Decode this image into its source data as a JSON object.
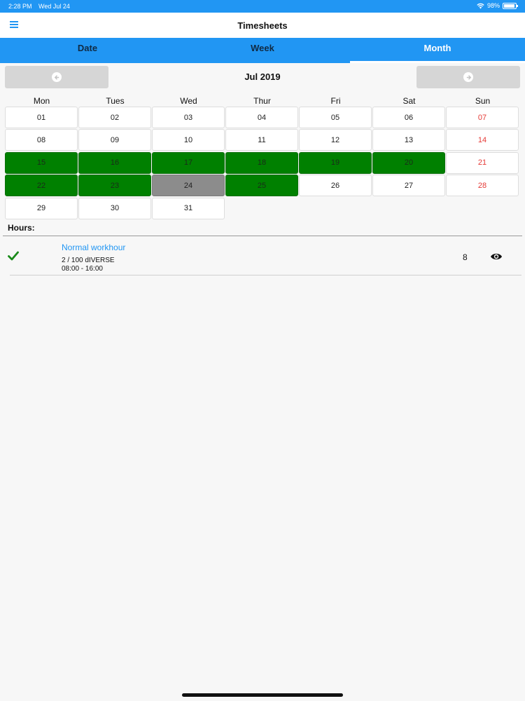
{
  "status_bar": {
    "time": "2:28 PM",
    "date": "Wed Jul 24",
    "battery": "98%"
  },
  "header": {
    "title": "Timesheets",
    "menu_icon": "hamburger-icon"
  },
  "tabs": [
    {
      "label": "Date",
      "active": false
    },
    {
      "label": "Week",
      "active": false
    },
    {
      "label": "Month",
      "active": true
    }
  ],
  "month_nav": {
    "label": "Jul 2019",
    "prev_icon": "arrow-left-circle-icon",
    "next_icon": "arrow-right-circle-icon"
  },
  "weekdays": [
    "Mon",
    "Tues",
    "Wed",
    "Thur",
    "Fri",
    "Sat",
    "Sun"
  ],
  "calendar": {
    "weeks": [
      [
        "01",
        "02",
        "03",
        "04",
        "05",
        "06",
        "07"
      ],
      [
        "08",
        "09",
        "10",
        "11",
        "12",
        "13",
        "14"
      ],
      [
        "15",
        "16",
        "17",
        "18",
        "19",
        "20",
        "21"
      ],
      [
        "22",
        "23",
        "24",
        "25",
        "26",
        "27",
        "28"
      ],
      [
        "29",
        "30",
        "31",
        "",
        "",
        "",
        ""
      ]
    ],
    "green_days": [
      "15",
      "16",
      "17",
      "18",
      "19",
      "20",
      "22",
      "23",
      "25"
    ],
    "today": "24",
    "colors": {
      "green": "#008000",
      "today": "#8c8c8c",
      "sunday": "#e53935",
      "accent": "#2196f3"
    }
  },
  "hours": {
    "label": "Hours:",
    "entries": [
      {
        "title": "Normal workhour",
        "project": "2 / 100 dIVERSE",
        "time": "08:00 - 16:00",
        "hours": "8",
        "status_icon": "checkmark-icon",
        "action_icon": "eye-icon"
      }
    ]
  }
}
